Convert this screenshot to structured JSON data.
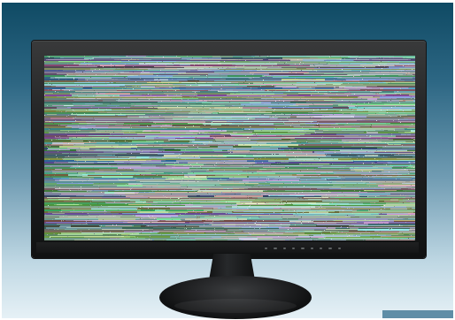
{
  "scene": {
    "subject": "monitor",
    "screen_content": "static",
    "control_buttons": 9
  },
  "colors": {
    "background_top": "#0f4a64",
    "background_bottom": "#e6f1f6",
    "bezel": "#1f2021",
    "screen_tint": "#60716d"
  },
  "icons": {
    "monitor": "monitor-icon",
    "stand": "stand-icon"
  }
}
